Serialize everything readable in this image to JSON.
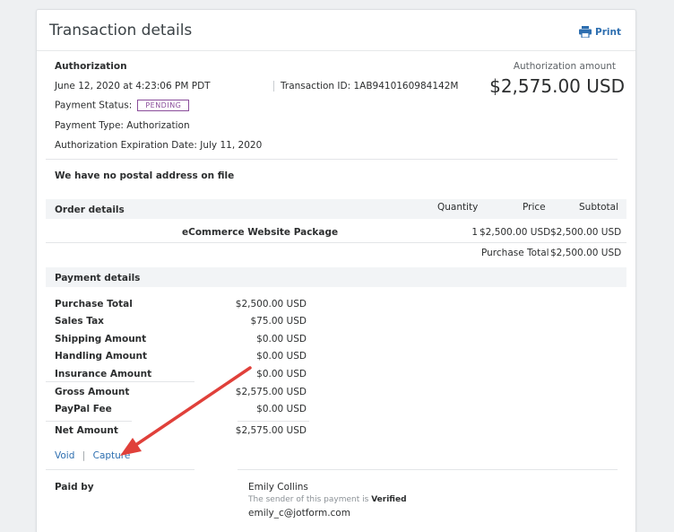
{
  "header": {
    "title": "Transaction details",
    "print_label": "Print"
  },
  "authorization": {
    "heading": "Authorization",
    "datetime": "June 12, 2020 at 4:23:06 PM PDT",
    "transaction_id": "Transaction ID: 1AB9410160984142M",
    "status_label": "Payment Status:",
    "status_value": "PENDING",
    "payment_type": "Payment Type: Authorization",
    "expiration": "Authorization Expiration Date: July 11, 2020",
    "amount_label": "Authorization amount",
    "amount_value": "$2,575.00 USD"
  },
  "postal_note": "We have no postal address on file",
  "order": {
    "heading": "Order details",
    "col_quantity": "Quantity",
    "col_price": "Price",
    "col_subtotal": "Subtotal",
    "item_name": "eCommerce Website Package",
    "item_quantity": "1",
    "item_price": "$2,500.00 USD",
    "item_subtotal": "$2,500.00 USD",
    "total_label": "Purchase Total",
    "total_value": "$2,500.00 USD"
  },
  "payment": {
    "heading": "Payment details",
    "rows": [
      {
        "label": "Purchase Total",
        "value": "$2,500.00 USD"
      },
      {
        "label": "Sales Tax",
        "value": "$75.00 USD"
      },
      {
        "label": "Shipping Amount",
        "value": "$0.00 USD"
      },
      {
        "label": "Handling Amount",
        "value": "$0.00 USD"
      },
      {
        "label": "Insurance Amount",
        "value": "$0.00 USD"
      },
      {
        "label": "Gross Amount",
        "value": "$2,575.00 USD"
      },
      {
        "label": "PayPal Fee",
        "value": "$0.00 USD"
      },
      {
        "label": "Net Amount",
        "value": "$2,575.00 USD"
      }
    ]
  },
  "actions": {
    "void": "Void",
    "separator": "|",
    "capture": "Capture"
  },
  "paid_by": {
    "label": "Paid by",
    "name": "Emily Collins",
    "verified_prefix": "The sender of this payment is",
    "verified_word": "Verified",
    "email": "emily_c@jotform.com"
  },
  "colors": {
    "link": "#2e6fb0",
    "pending": "#8a4d9a",
    "arrow": "#e0403a"
  }
}
